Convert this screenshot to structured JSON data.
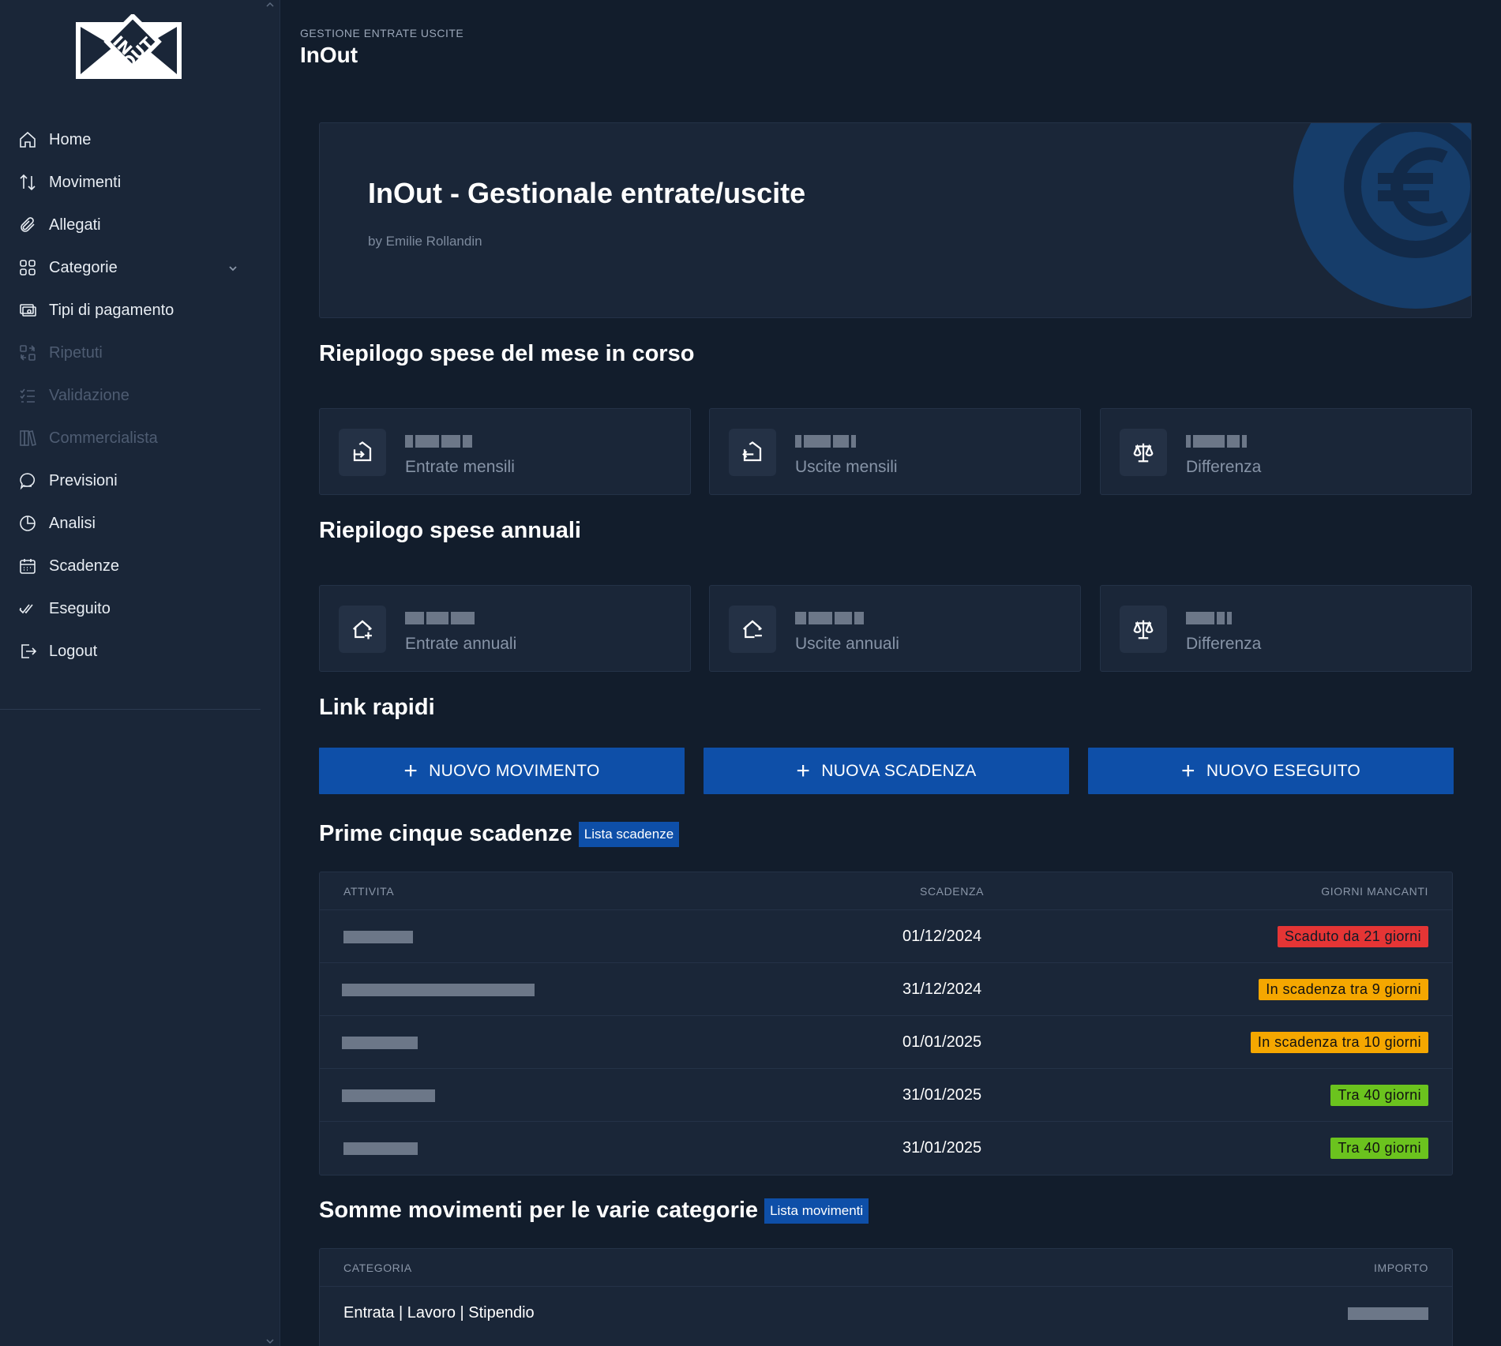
{
  "sidebar": {
    "items": [
      {
        "label": "Home",
        "icon": "home-icon",
        "disabled": false
      },
      {
        "label": "Movimenti",
        "icon": "arrows-updown-icon",
        "disabled": false
      },
      {
        "label": "Allegati",
        "icon": "paperclip-icon",
        "disabled": false
      },
      {
        "label": "Categorie",
        "icon": "grid-icon",
        "disabled": false,
        "expandable": true
      },
      {
        "label": "Tipi di pagamento",
        "icon": "payment-icon",
        "disabled": false
      },
      {
        "label": "Ripetuti",
        "icon": "repeat-icon",
        "disabled": true
      },
      {
        "label": "Validazione",
        "icon": "checklist-icon",
        "disabled": true
      },
      {
        "label": "Commercialista",
        "icon": "books-icon",
        "disabled": true
      },
      {
        "label": "Previsioni",
        "icon": "chat-icon",
        "disabled": false
      },
      {
        "label": "Analisi",
        "icon": "pie-chart-icon",
        "disabled": false
      },
      {
        "label": "Scadenze",
        "icon": "calendar-icon",
        "disabled": false
      },
      {
        "label": "Eseguito",
        "icon": "double-check-icon",
        "disabled": false
      },
      {
        "label": "Logout",
        "icon": "logout-icon",
        "disabled": false
      }
    ]
  },
  "header": {
    "breadcrumb": "GESTIONE ENTRATE USCITE",
    "title": "InOut"
  },
  "hero": {
    "title": "InOut - Gestionale entrate/uscite",
    "author": "by Emilie Rollandin"
  },
  "monthly": {
    "title": "Riepilogo spese del mese in corso",
    "cards": [
      {
        "label": "Entrate mensili",
        "icon": "entrate-icon"
      },
      {
        "label": "Uscite mensili",
        "icon": "uscite-icon"
      },
      {
        "label": "Differenza",
        "icon": "scale-icon"
      }
    ]
  },
  "annual": {
    "title": "Riepilogo spese annuali",
    "cards": [
      {
        "label": "Entrate annuali",
        "icon": "house-plus-icon"
      },
      {
        "label": "Uscite annuali",
        "icon": "house-minus-icon"
      },
      {
        "label": "Differenza",
        "icon": "scale-icon"
      }
    ]
  },
  "quick_links": {
    "title": "Link rapidi",
    "buttons": [
      "NUOVO MOVIMENTO",
      "NUOVA SCADENZA",
      "NUOVO ESEGUITO"
    ]
  },
  "deadlines": {
    "title": "Prime cinque scadenze",
    "link": "Lista scadenze",
    "columns": [
      "ATTIVITA",
      "SCADENZA",
      "GIORNI MANCANTI"
    ],
    "rows": [
      {
        "date": "01/12/2024",
        "status": "Scaduto da 21 giorni",
        "color": "#e53535"
      },
      {
        "date": "31/12/2024",
        "status": "In scadenza tra 9 giorni",
        "color": "#f5a700"
      },
      {
        "date": "01/01/2025",
        "status": "In scadenza tra 10 giorni",
        "color": "#f5a700"
      },
      {
        "date": "31/01/2025",
        "status": "Tra 40 giorni",
        "color": "#6bc31e"
      },
      {
        "date": "31/01/2025",
        "status": "Tra 40 giorni",
        "color": "#6bc31e"
      }
    ]
  },
  "categories": {
    "title": "Somme movimenti per le varie categorie",
    "link": "Lista movimenti",
    "columns": [
      "CATEGORIA",
      "IMPORTO"
    ],
    "rows": [
      {
        "category": "Entrata | Lavoro | Stipendio"
      }
    ]
  }
}
